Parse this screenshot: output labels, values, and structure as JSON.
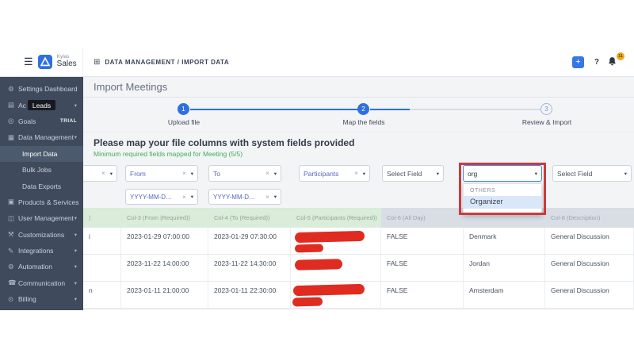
{
  "ui": {
    "hamburger": "☰",
    "plus": "+",
    "help": "?",
    "clear": "×",
    "caret": "▾",
    "breadcrumb_icon": "⊞"
  },
  "brand": {
    "top": "Kylas",
    "bottom": "Sales"
  },
  "topbar": {
    "breadcrumb": "DATA MANAGEMENT / IMPORT DATA",
    "notification_count": "11"
  },
  "sidebar": {
    "items": [
      {
        "icon": "⚙",
        "label": "Settings Dashboard"
      },
      {
        "icon": "▤",
        "label": "Ac",
        "tooltip": "Leads",
        "chevron": "▾"
      },
      {
        "icon": "◎",
        "label": "Goals",
        "badge": "TRIAL"
      },
      {
        "icon": "▦",
        "label": "Data Management",
        "chevron": "▾"
      },
      {
        "label": "Import Data"
      },
      {
        "label": "Bulk Jobs"
      },
      {
        "label": "Data Exports"
      },
      {
        "icon": "▣",
        "label": "Products & Services"
      },
      {
        "icon": "◫",
        "label": "User Management",
        "chevron": "▾"
      },
      {
        "icon": "⚒",
        "label": "Customizations",
        "chevron": "▾"
      },
      {
        "icon": "✎",
        "label": "Integrations",
        "chevron": "▾"
      },
      {
        "icon": "⚙",
        "label": "Automation",
        "chevron": "▾"
      },
      {
        "icon": "☎",
        "label": "Communication",
        "chevron": "▾"
      },
      {
        "icon": "⊙",
        "label": "Billing",
        "chevron": "▾"
      }
    ]
  },
  "page": {
    "title": "Import Meetings"
  },
  "stepper": {
    "steps": [
      {
        "num": "1",
        "label": "Upload file"
      },
      {
        "num": "2",
        "label": "Map the fields"
      },
      {
        "num": "3",
        "label": "Review & Import"
      }
    ]
  },
  "mapping": {
    "heading": "Please map your file columns with system fields provided",
    "subheading": "Minimum required fields mapped for Meeting (5/5)",
    "selects": [
      {
        "value": ""
      },
      {
        "value": "From"
      },
      {
        "value": "To"
      },
      {
        "value": "Participants"
      },
      {
        "value": "Select Field"
      },
      {
        "value": "org"
      },
      {
        "value": "Select Field"
      }
    ],
    "date_formats": [
      {
        "value": "YYYY-MM-DD H..."
      },
      {
        "value": "YYYY-MM-DD H..."
      }
    ],
    "open_dropdown": {
      "group": "OTHERS",
      "option": "Organizer"
    }
  },
  "table": {
    "headers": [
      ")",
      "Col-3 (From (Required))",
      "Col-4 (To (Required))",
      "Col-5 (Participants (Required))",
      "Col-6 (All Day)",
      "",
      "Col-8 (Description)"
    ],
    "rows": [
      {
        "c0": "i",
        "c1": "2023-01-29 07:00:00",
        "c2": "2023-01-29 07:30:00",
        "c4": "FALSE",
        "c5": "Denmark",
        "c6": "General Discussion"
      },
      {
        "c0": "",
        "c1": "2023-11-22 14:00:00",
        "c2": "2023-11-22 14:30:00",
        "c4": "FALSE",
        "c5": "Jordan",
        "c6": "General Discussion"
      },
      {
        "c0": "n",
        "c1": "2023-01-11 21:00:00",
        "c2": "2023-01-11 22:30:00",
        "c4": "FALSE",
        "c5": "Amsterdam",
        "c6": "General Discussion"
      }
    ]
  },
  "colors": {
    "accent": "#2f6fe0",
    "sidebar_bg": "#3f4b5d",
    "success_green": "#3faf5f",
    "redaction_red": "#e02b20",
    "annotation_red": "#c83c3c"
  }
}
